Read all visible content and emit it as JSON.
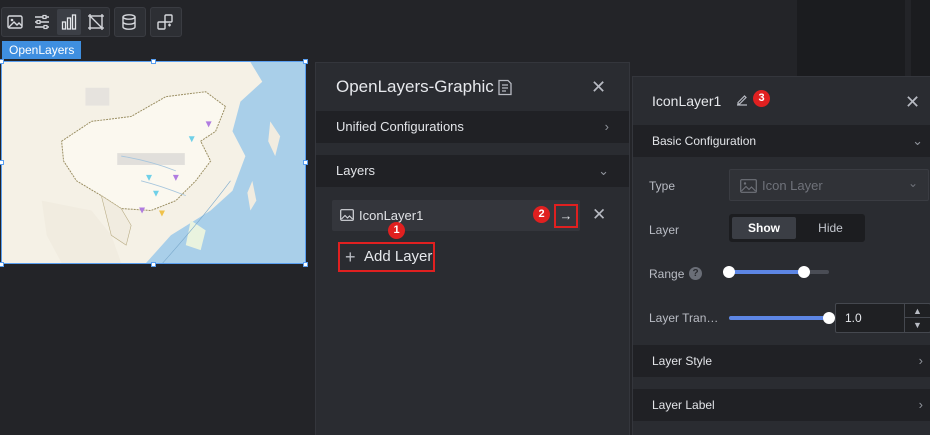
{
  "toolbar": {
    "group1": [
      "image-icon",
      "sliders-icon",
      "bar-chart-icon",
      "crop-frame-icon"
    ],
    "group2": [
      "database-icon"
    ],
    "group3": [
      "shuffle-link-icon"
    ]
  },
  "map": {
    "tag": "OpenLayers"
  },
  "panel1": {
    "title": "OpenLayers-Graphic",
    "sections": {
      "unified": "Unified Configurations",
      "layers": "Layers"
    },
    "layer_item": "IconLayer1",
    "arrow": "→",
    "add_layer": "Add Layer",
    "badges": [
      "1",
      "2"
    ]
  },
  "panel2": {
    "title": "IconLayer1",
    "badge": "3",
    "basic_config": "Basic Configuration",
    "type_label": "Type",
    "type_value": "Icon Layer",
    "layer_label": "Layer",
    "show": "Show",
    "hide": "Hide",
    "range_label": "Range",
    "range_values": [
      0,
      0.75
    ],
    "transparency_label": "Layer Tran…",
    "transparency_value": "1.0",
    "transparency_fraction": 1.0,
    "layer_style": "Layer Style",
    "layer_label_section": "Layer Label",
    "help_glyph": "?"
  },
  "colors": {
    "accent": "#5d86e4",
    "highlight": "#e02020",
    "map_tag": "#3f8fe0"
  }
}
